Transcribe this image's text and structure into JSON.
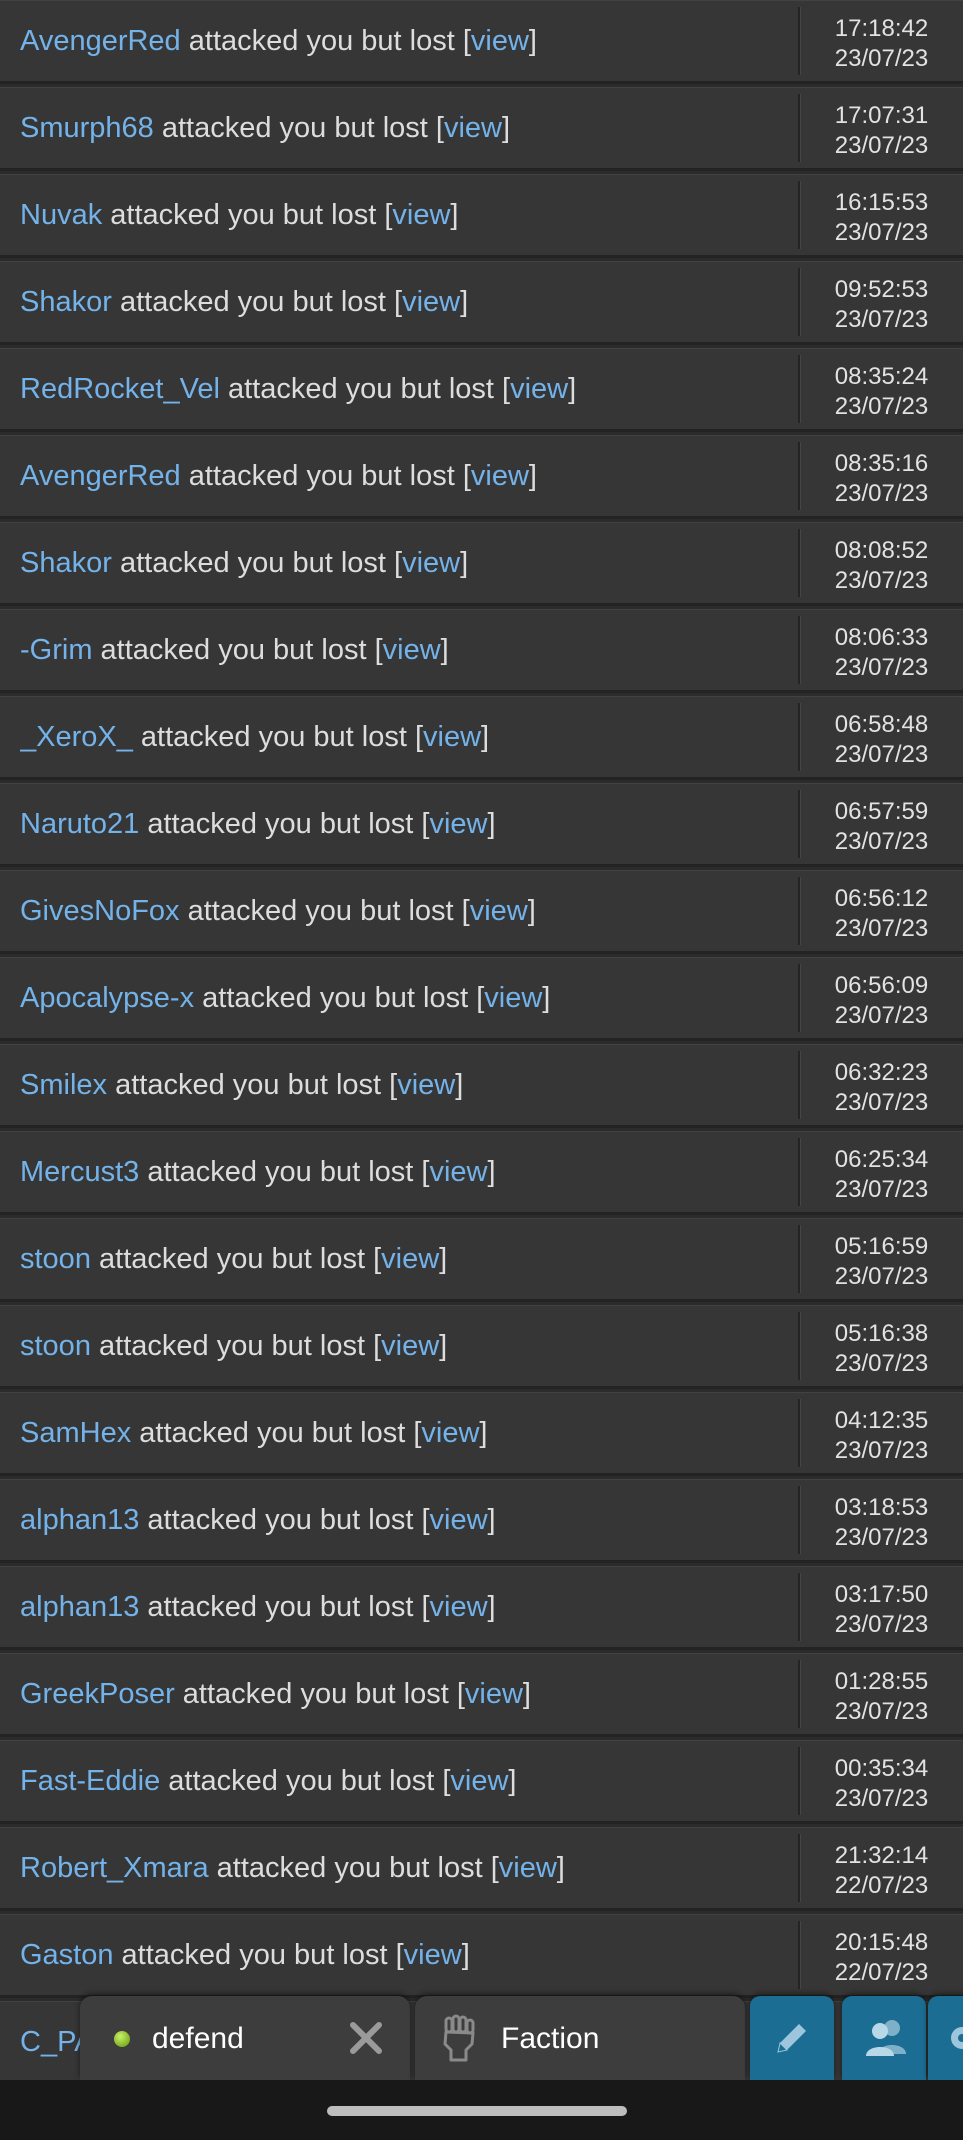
{
  "attack_log": {
    "message_text": " attacked you but lost [",
    "link_text": "view",
    "closing_bracket": "]",
    "rows": [
      {
        "attacker": "AvengerRed",
        "time": "17:18:42",
        "date": "23/07/23"
      },
      {
        "attacker": "Smurph68",
        "time": "17:07:31",
        "date": "23/07/23"
      },
      {
        "attacker": "Nuvak",
        "time": "16:15:53",
        "date": "23/07/23"
      },
      {
        "attacker": "Shakor",
        "time": "09:52:53",
        "date": "23/07/23"
      },
      {
        "attacker": "RedRocket_Vel",
        "time": "08:35:24",
        "date": "23/07/23"
      },
      {
        "attacker": "AvengerRed",
        "time": "08:35:16",
        "date": "23/07/23"
      },
      {
        "attacker": "Shakor",
        "time": "08:08:52",
        "date": "23/07/23"
      },
      {
        "attacker": "-Grim",
        "time": "08:06:33",
        "date": "23/07/23"
      },
      {
        "attacker": "_XeroX_",
        "time": "06:58:48",
        "date": "23/07/23"
      },
      {
        "attacker": "Naruto21",
        "time": "06:57:59",
        "date": "23/07/23"
      },
      {
        "attacker": "GivesNoFox",
        "time": "06:56:12",
        "date": "23/07/23"
      },
      {
        "attacker": "Apocalypse-x",
        "time": "06:56:09",
        "date": "23/07/23"
      },
      {
        "attacker": "Smilex",
        "time": "06:32:23",
        "date": "23/07/23"
      },
      {
        "attacker": "Mercust3",
        "time": "06:25:34",
        "date": "23/07/23"
      },
      {
        "attacker": "stoon",
        "time": "05:16:59",
        "date": "23/07/23"
      },
      {
        "attacker": "stoon",
        "time": "05:16:38",
        "date": "23/07/23"
      },
      {
        "attacker": "SamHex",
        "time": "04:12:35",
        "date": "23/07/23"
      },
      {
        "attacker": "alphan13",
        "time": "03:18:53",
        "date": "23/07/23"
      },
      {
        "attacker": "alphan13",
        "time": "03:17:50",
        "date": "23/07/23"
      },
      {
        "attacker": "GreekPoser",
        "time": "01:28:55",
        "date": "23/07/23"
      },
      {
        "attacker": "Fast-Eddie",
        "time": "00:35:34",
        "date": "23/07/23"
      },
      {
        "attacker": "Robert_Xmara",
        "time": "21:32:14",
        "date": "22/07/23"
      },
      {
        "attacker": "Gaston",
        "time": "20:15:48",
        "date": "22/07/23"
      },
      {
        "attacker": "C_PA",
        "time": "",
        "date": ""
      }
    ]
  },
  "chat_dock": {
    "defend_tab": {
      "label": "defend",
      "status": "online",
      "status_color": "#8fc33a"
    },
    "faction_tab": {
      "label": "Faction",
      "icon": "raised-fist-icon"
    },
    "buttons": [
      {
        "icon": "pencil-icon"
      },
      {
        "icon": "people-icon"
      },
      {
        "icon": "gear-icon"
      }
    ],
    "accent_color": "#1c6d93"
  },
  "link_color": "#74b3ea"
}
